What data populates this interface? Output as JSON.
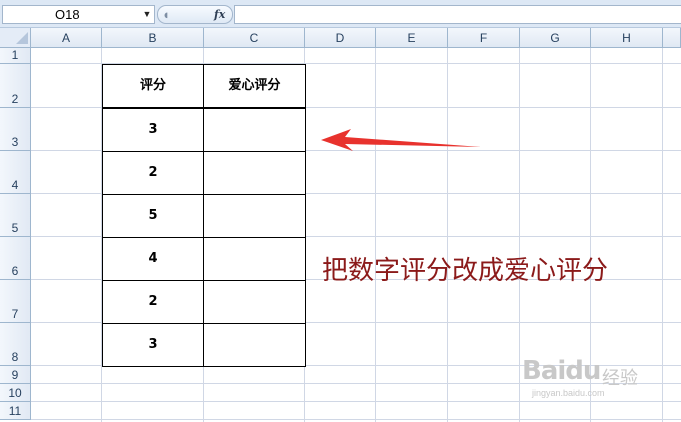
{
  "name_box": {
    "value": "O18",
    "dropdown_icon": "chevron-down-icon"
  },
  "formula_bar": {
    "fx_label": "fx",
    "value": ""
  },
  "columns": [
    "A",
    "B",
    "C",
    "D",
    "E",
    "F",
    "G",
    "H"
  ],
  "rows": [
    "1",
    "2",
    "3",
    "4",
    "5",
    "6",
    "7",
    "8",
    "9",
    "10",
    "11"
  ],
  "table": {
    "headers": [
      "评分",
      "爱心评分"
    ],
    "rows": [
      {
        "score": "3",
        "heart": ""
      },
      {
        "score": "2",
        "heart": ""
      },
      {
        "score": "5",
        "heart": ""
      },
      {
        "score": "4",
        "heart": ""
      },
      {
        "score": "2",
        "heart": ""
      },
      {
        "score": "3",
        "heart": ""
      }
    ]
  },
  "annotation": {
    "text": "把数字评分改成爱心评分",
    "color": "#8b1a1a",
    "arrow_color": "#e8322d"
  },
  "watermark": {
    "logo": "Baidu",
    "text": "经验",
    "url": "jingyan.baidu.com"
  },
  "colors": {
    "header_bg": "#e4ecf7",
    "gridline": "#d0d7e5",
    "toolbar_bg": "#dde8f5"
  }
}
